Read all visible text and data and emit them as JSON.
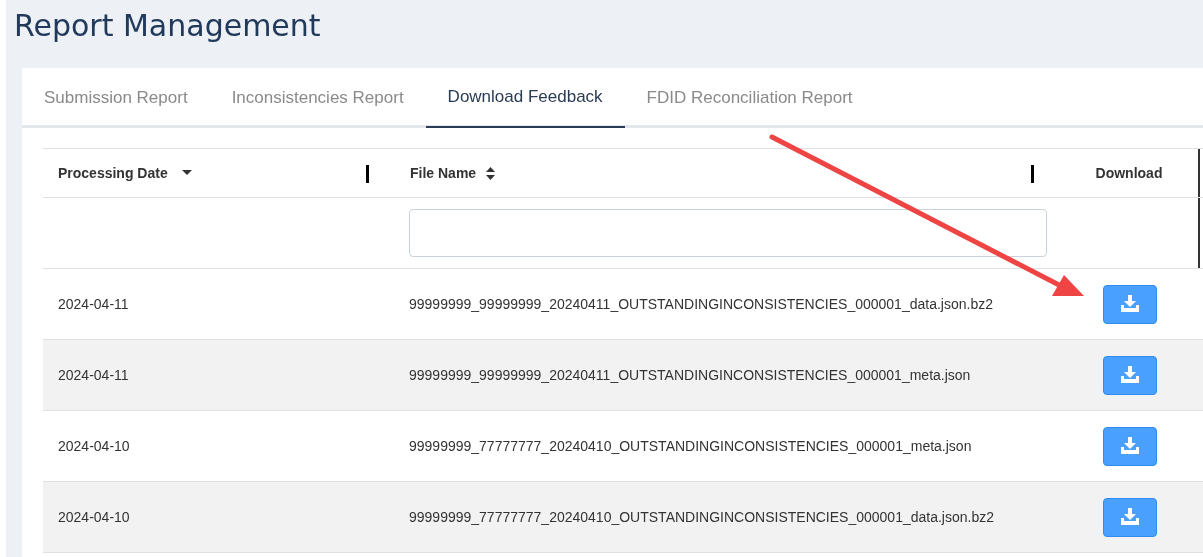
{
  "title": "Report Management",
  "tabs": [
    {
      "label": "Submission Report",
      "selected": false
    },
    {
      "label": "Inconsistencies Report",
      "selected": false
    },
    {
      "label": "Download Feedback",
      "selected": true
    },
    {
      "label": "FDID Reconciliation Report",
      "selected": false
    }
  ],
  "table": {
    "columns": [
      {
        "label": "Processing Date",
        "sorted": true,
        "resizable": true
      },
      {
        "label": "File Name",
        "sorted": false,
        "resizable": true,
        "filter": true
      },
      {
        "label": "Download"
      }
    ],
    "rows": [
      {
        "date": "2024-04-11",
        "file": "99999999_99999999_20240411_OUTSTANDINGINCONSISTENCIES_000001_data.json.bz2"
      },
      {
        "date": "2024-04-11",
        "file": "99999999_99999999_20240411_OUTSTANDINGINCONSISTENCIES_000001_meta.json"
      },
      {
        "date": "2024-04-10",
        "file": "99999999_77777777_20240410_OUTSTANDINGINCONSISTENCIES_000001_meta.json"
      },
      {
        "date": "2024-04-10",
        "file": "99999999_77777777_20240410_OUTSTANDINGINCONSISTENCIES_000001_data.json.bz2"
      }
    ]
  }
}
